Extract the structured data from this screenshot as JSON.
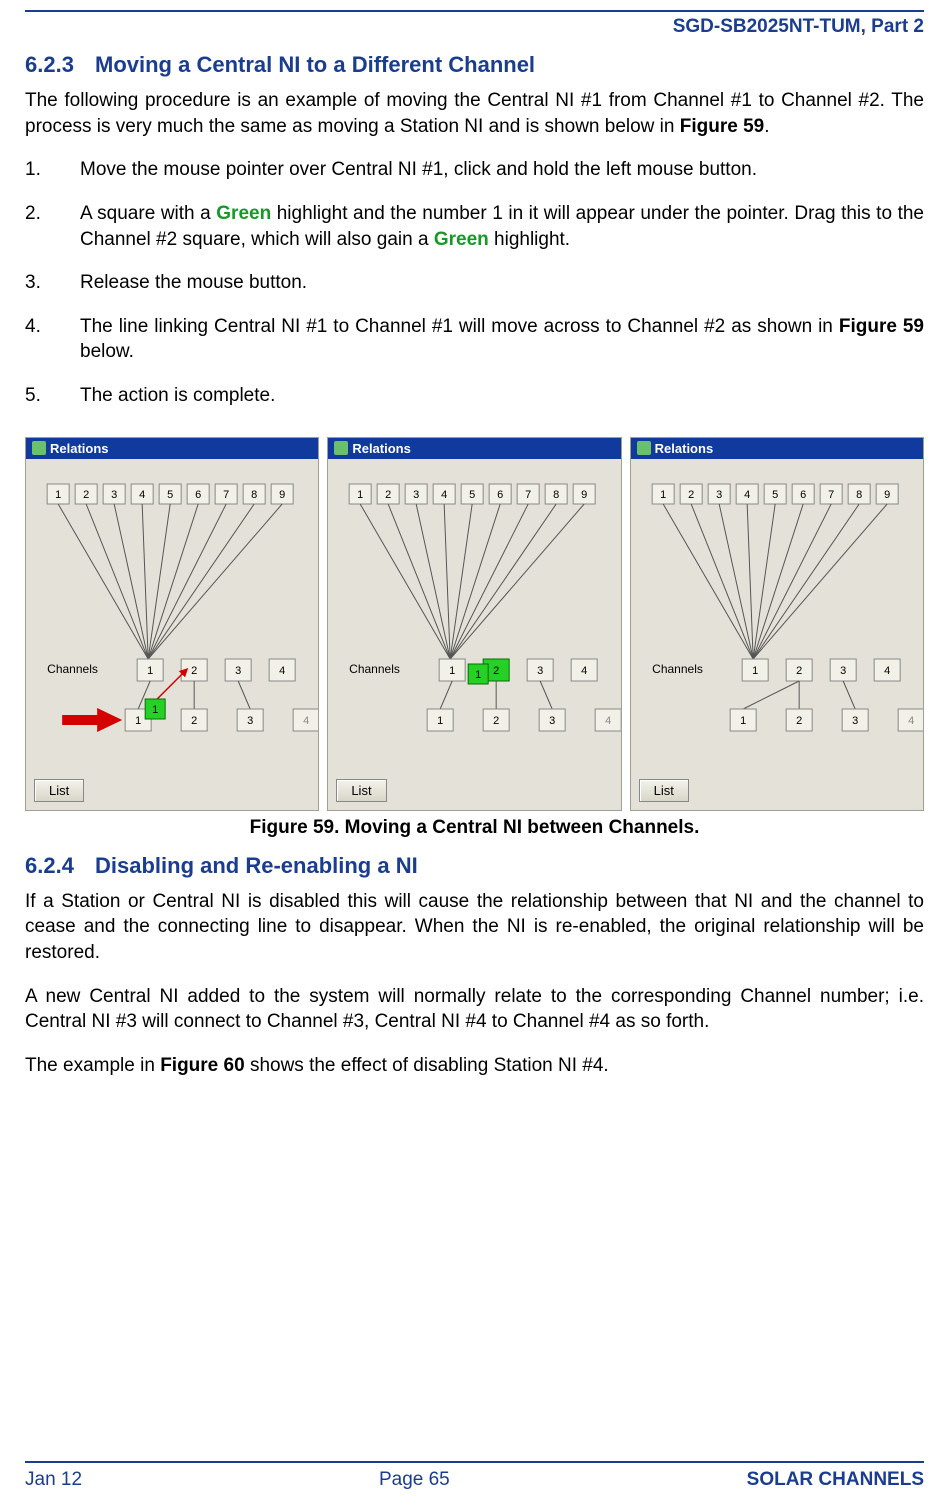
{
  "header": {
    "doc_id": "SGD-SB2025NT-TUM, Part 2"
  },
  "section623": {
    "number": "6.2.3",
    "title": "Moving a Central NI to a Different Channel",
    "intro_a": "The following procedure is an example of moving the Central NI #1 from Channel #1 to Channel #2.  The process is very much the same as moving a Station NI and is shown below in ",
    "intro_figref": "Figure 59",
    "intro_b": ".",
    "step1": "Move the mouse pointer over Central NI #1, click and hold the left mouse button.",
    "step2_a": "A square with a ",
    "step2_green1": "Green",
    "step2_b": " highlight and the number 1 in it will appear under the pointer.  Drag this to the Channel #2 square, which will also gain a ",
    "step2_green2": "Green",
    "step2_c": " highlight.",
    "step3": "Release the mouse button.",
    "step4_a": "The line linking Central NI #1 to Channel #1 will move across to Channel #2 as shown in ",
    "step4_figref": "Figure 59",
    "step4_b": " below.",
    "step5": "The action is complete."
  },
  "figure59": {
    "panel_title": "Relations",
    "channels_label": "Channels",
    "list_label": "List",
    "top_numbers": [
      "1",
      "2",
      "3",
      "4",
      "5",
      "6",
      "7",
      "8",
      "9"
    ],
    "channel_numbers": [
      "1",
      "2",
      "3",
      "4"
    ],
    "bottom_numbers": [
      "1",
      "2",
      "3",
      "4"
    ],
    "drag_label": "1",
    "caption": "Figure 59.  Moving a Central NI between Channels."
  },
  "section624": {
    "number": "6.2.4",
    "title": "Disabling and Re-enabling a NI",
    "p1": "If a Station or Central NI is disabled this will cause the relationship between that NI and the channel to cease and the connecting line to disappear.  When the NI is re-enabled, the original relationship will be restored.",
    "p2": "A new Central NI added to the system will normally relate to the corresponding Channel number; i.e. Central NI #3 will connect to Channel #3, Central NI #4 to Channel #4 as so forth.",
    "p3_a": "The example in ",
    "p3_figref": "Figure 60",
    "p3_b": " shows the effect of disabling Station NI #4."
  },
  "footer": {
    "date": "Jan 12",
    "page": "Page 65",
    "section": "SOLAR CHANNELS"
  }
}
